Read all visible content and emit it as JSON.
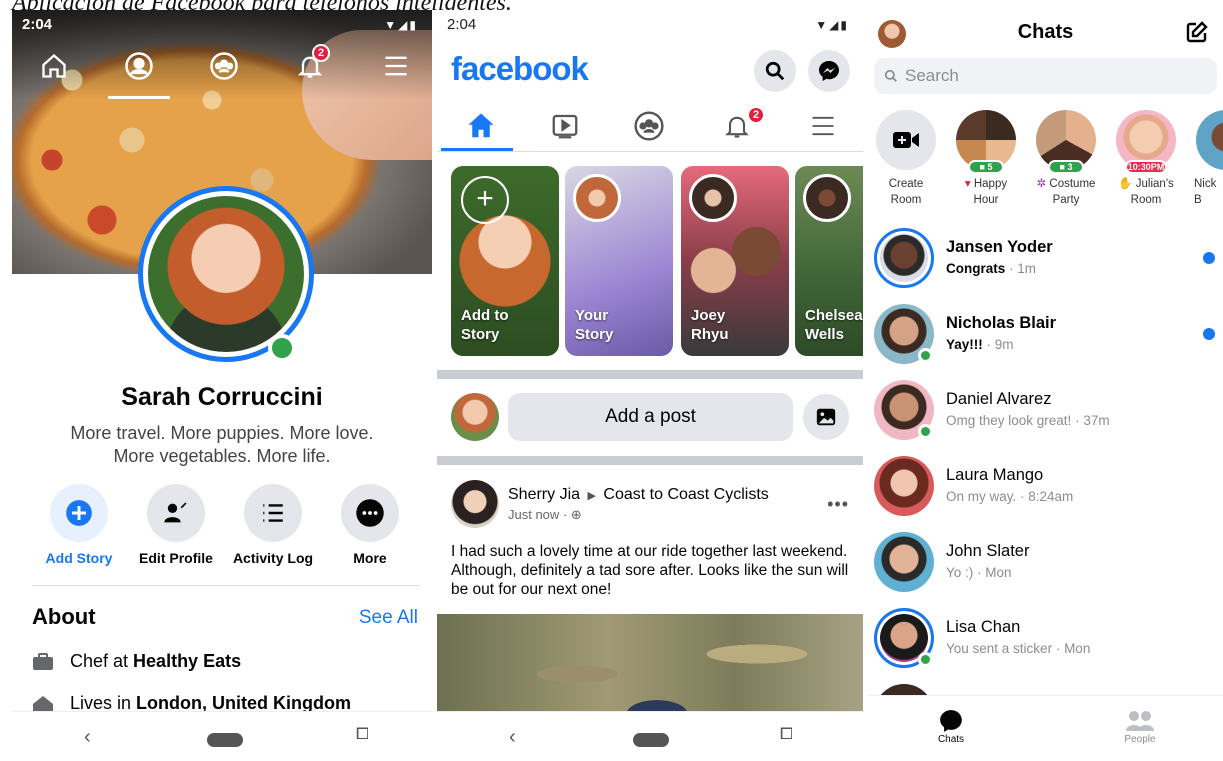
{
  "caption": "Aplicación de Facebook para teléfonos inteligentes.",
  "profile": {
    "status_time": "2:04",
    "notif_count": "2",
    "name": "Sarah Corruccini",
    "bio_line1": "More travel. More puppies. More love.",
    "bio_line2": "More vegetables. More life.",
    "actions": [
      "Add Story",
      "Edit Profile",
      "Activity Log",
      "More"
    ],
    "about_title": "About",
    "see_all": "See All",
    "work_prefix": "Chef at",
    "work_place": "Healthy Eats",
    "lives_prefix": "Lives in",
    "lives_place": "London, United Kingdom"
  },
  "feed": {
    "status_time": "2:04",
    "logo": "facebook",
    "notif_count": "2",
    "stories": [
      {
        "line1": "Add to",
        "line2": "Story"
      },
      {
        "line1": "Your",
        "line2": "Story"
      },
      {
        "line1": "Joey",
        "line2": "Rhyu"
      },
      {
        "line1": "Chelsea",
        "line2": "Wells"
      }
    ],
    "add_post": "Add a post",
    "post": {
      "author": "Sherry Jia",
      "group": "Coast to Coast Cyclists",
      "time": "Just now",
      "text": "I had such a lovely time at our ride together last weekend. Although, definitely a tad sore after. Looks like the sun will be out for our next one!"
    }
  },
  "messenger": {
    "title": "Chats",
    "search_placeholder": "Search",
    "rooms": [
      {
        "line1": "Create",
        "line2": "Room",
        "pill": ""
      },
      {
        "line1": "Happy",
        "line2": "Hour",
        "pill": "5"
      },
      {
        "line1": "Costume",
        "line2": "Party",
        "pill": "3"
      },
      {
        "line1": "Julian's",
        "line2": "Room",
        "pill": "10:30PM"
      },
      {
        "line1": "Nick",
        "line2": "B",
        "pill": ""
      }
    ],
    "chats": [
      {
        "name": "Jansen Yoder",
        "message": "Congrats",
        "time": "1m"
      },
      {
        "name": "Nicholas Blair",
        "message": "Yay!!!",
        "time": "9m"
      },
      {
        "name": "Daniel Alvarez",
        "message": "Omg they look great!",
        "time": "37m"
      },
      {
        "name": "Laura Mango",
        "message": "On my way.",
        "time": "8:24am"
      },
      {
        "name": "John Slater",
        "message": "Yo :)",
        "time": "Mon"
      },
      {
        "name": "Lisa Chan",
        "message": "You sent a sticker",
        "time": "Mon"
      }
    ],
    "tabs": [
      "Chats",
      "People"
    ],
    "colors": {
      "accent": "#1877f2",
      "online": "#31a24c",
      "badge": "#e41e3f"
    }
  }
}
